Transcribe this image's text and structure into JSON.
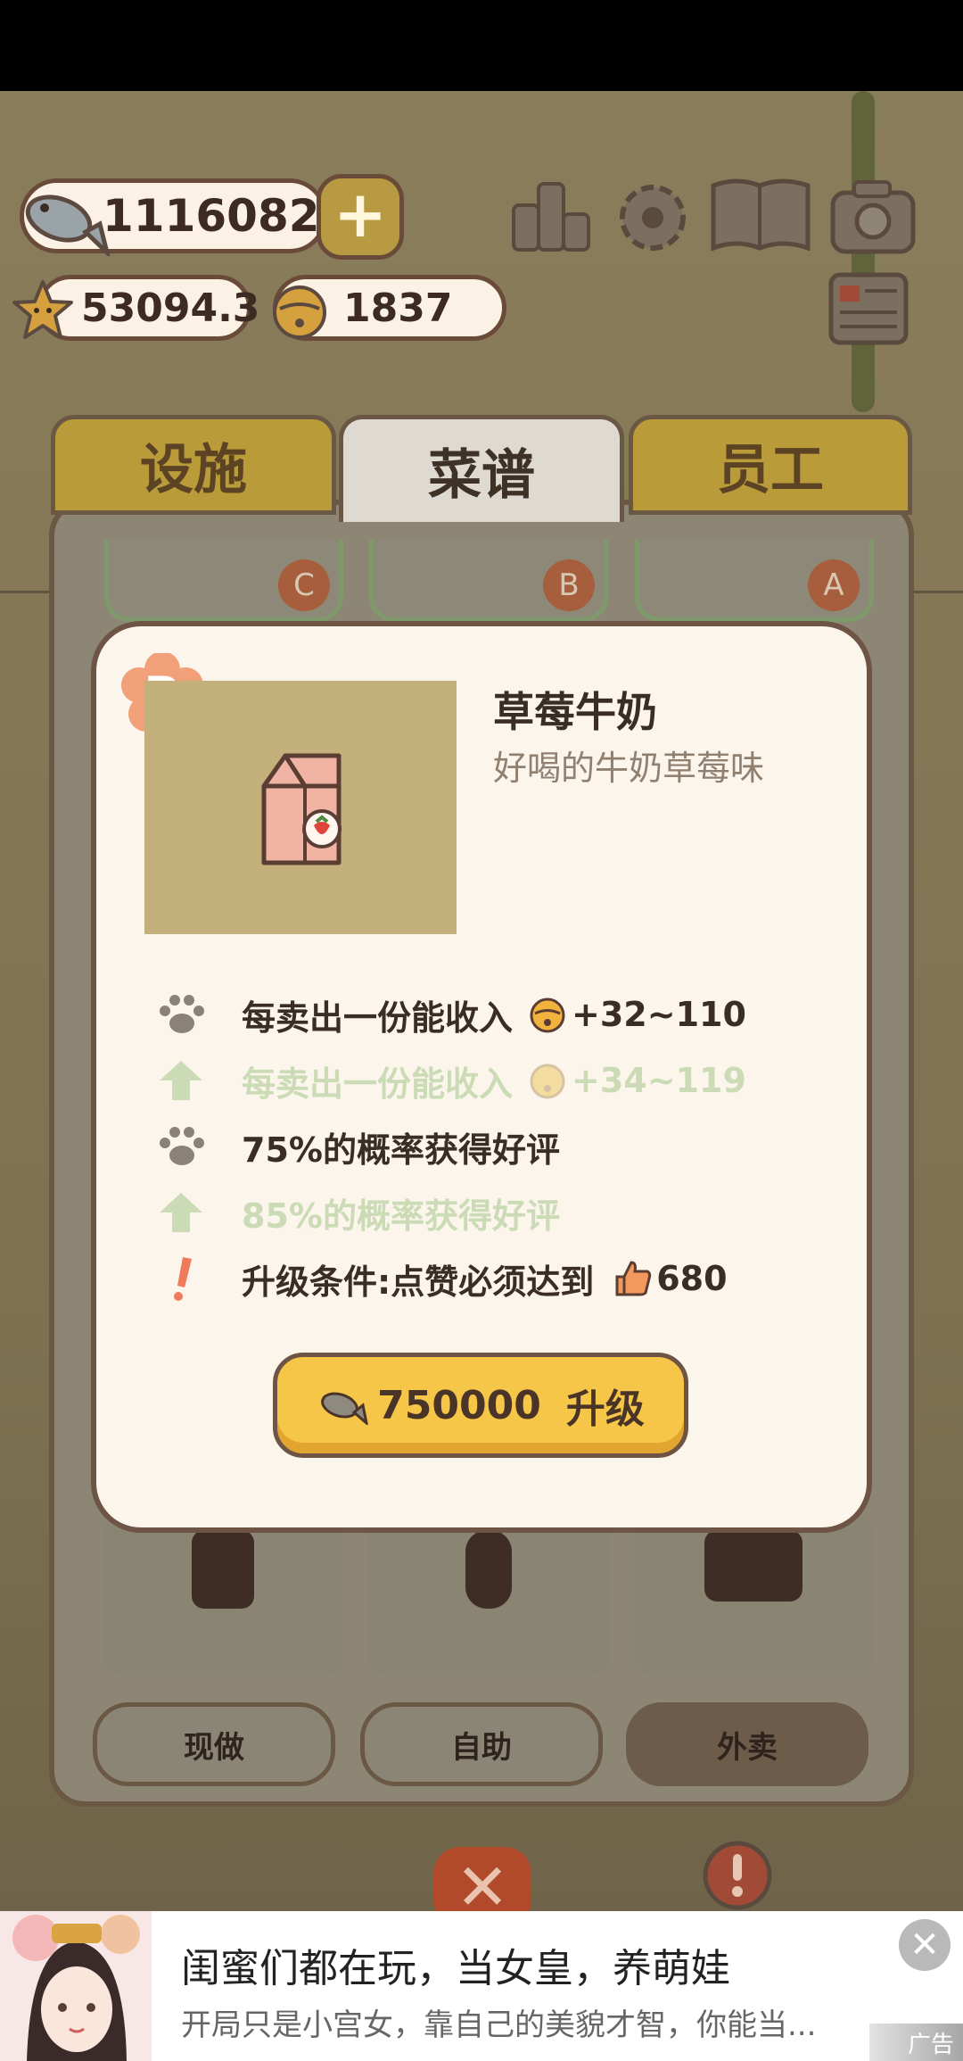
{
  "currency": {
    "fish": "1116082",
    "stars": "53094.3",
    "bells": "1837"
  },
  "toolbar_icons": [
    "ranking-icon",
    "settings-gear-icon",
    "recipe-book-icon",
    "camera-icon",
    "notice-board-icon"
  ],
  "tabs": [
    {
      "label": "设施",
      "active": false
    },
    {
      "label": "菜谱",
      "active": true
    },
    {
      "label": "员工",
      "active": false
    }
  ],
  "card_ranks": [
    "C",
    "B",
    "A"
  ],
  "modes": [
    "现做",
    "自助",
    "外卖"
  ],
  "recipe": {
    "rank": "B",
    "name": "草莓牛奶",
    "description": "好喝的牛奶草莓味",
    "income_label": "每卖出一份能收入",
    "income": "+32~110",
    "next_income_label": "每卖出一份能收入",
    "next_income": "+34~119",
    "praise": "75%的概率获得好评",
    "next_praise": "85%的概率获得好评",
    "requirement_label": "升级条件:点赞必须达到",
    "requirement_value": "680",
    "upgrade_cost": "750000",
    "upgrade_label": "升级"
  },
  "ad": {
    "title": "闺蜜们都在玩，当女皇，养萌娃",
    "description": "开局只是小宫女，靠自己的美貌才智，你能当...",
    "tag": "广告"
  },
  "colors": {
    "accent_yellow": "#f6c648",
    "brown_outline": "#6e5444",
    "faded_green": "#cadbb6",
    "dialog_bg": "#fcf5ec"
  }
}
